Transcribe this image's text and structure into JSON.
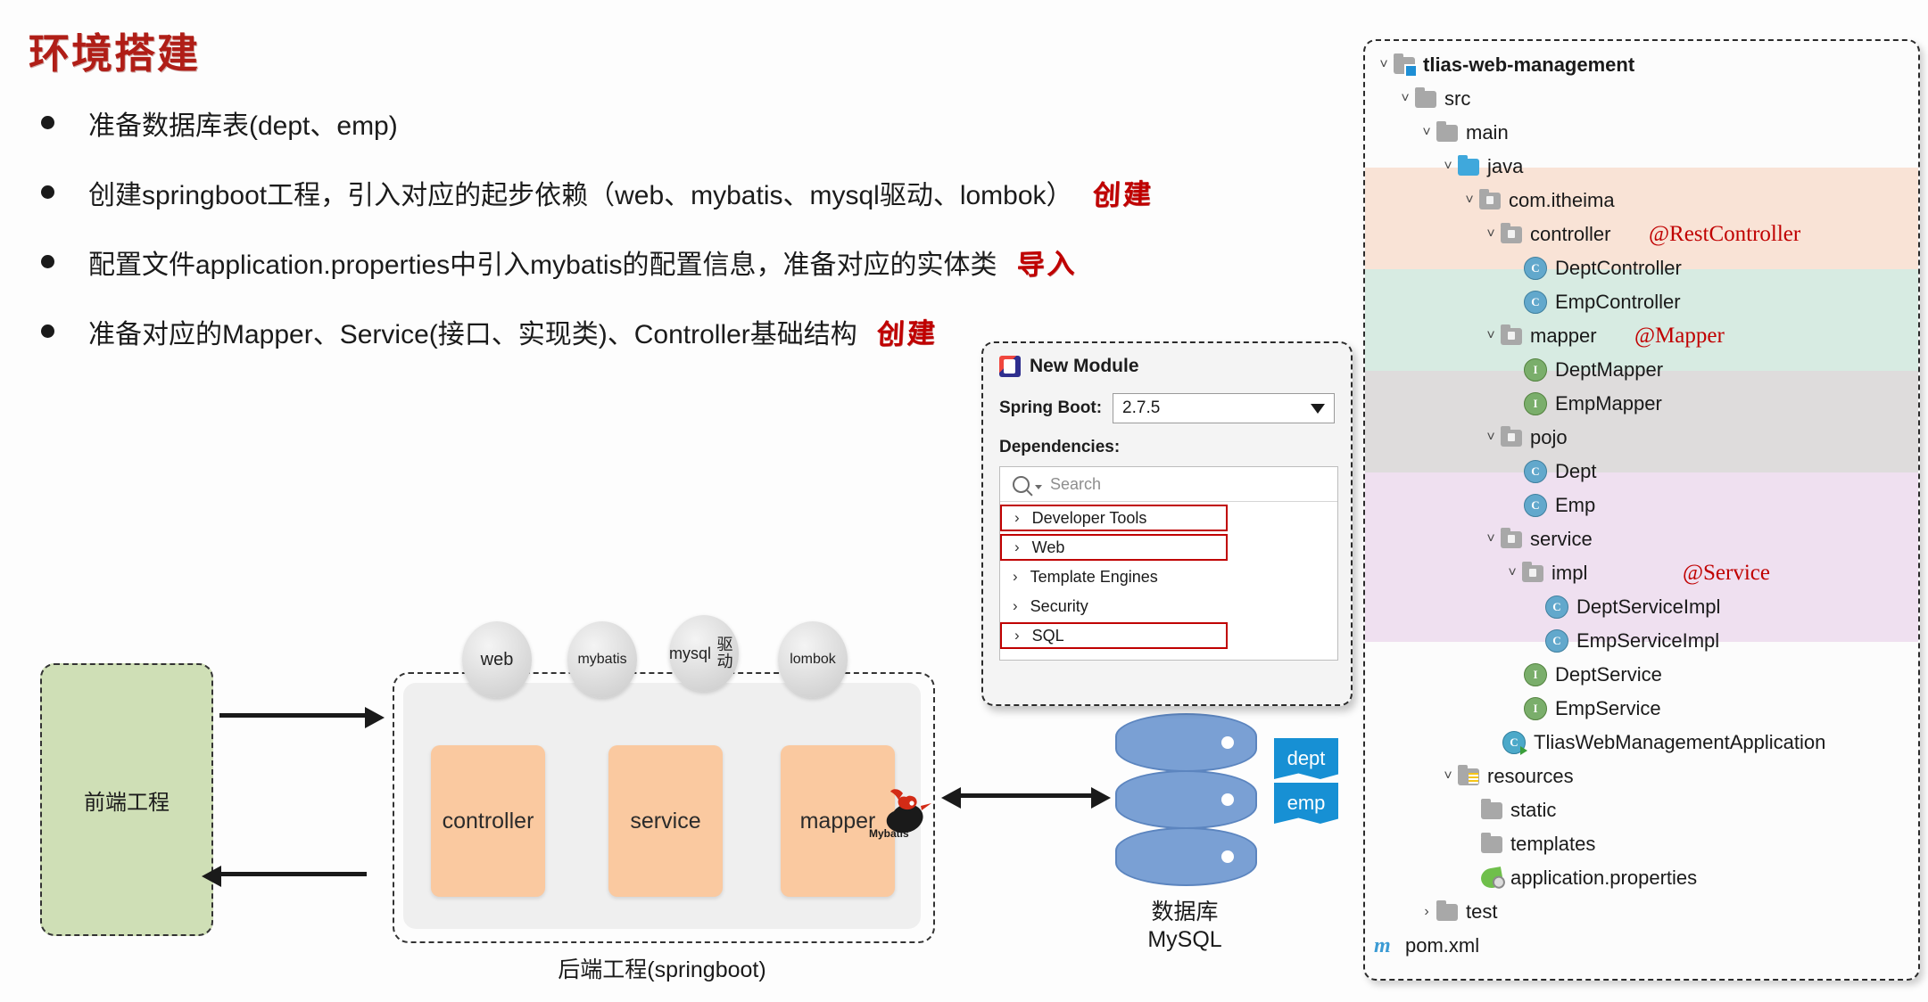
{
  "slide": {
    "title": "环境搭建",
    "title_color": "#B01E17"
  },
  "bullets": [
    {
      "text": "准备数据库表(dept、emp)",
      "annotation": ""
    },
    {
      "text": "创建springboot工程，引入对应的起步依赖（web、mybatis、mysql驱动、lombok）",
      "annotation": "创建"
    },
    {
      "text": "配置文件application.properties中引入mybatis的配置信息，准备对应的实体类",
      "annotation": "导入"
    },
    {
      "text": "准备对应的Mapper、Service(接口、实现类)、Controller基础结构",
      "annotation": "创建"
    }
  ],
  "architecture": {
    "frontend_label": "前端工程",
    "backend_label": "后端工程(springboot)",
    "layers": [
      "controller",
      "service",
      "mapper"
    ],
    "dependencies": [
      "web",
      "mybatis",
      "mysql\n驱动",
      "lombok"
    ],
    "dependency_labels": {
      "web": "web",
      "mybatis": "mybatis",
      "mysql_line1": "mysql",
      "mysql_line2": "驱动",
      "lombok": "lombok"
    },
    "mybatis_logo_caption": "Mybatis",
    "database": {
      "label_line1": "数据库",
      "label_line2": "MySQL",
      "tables": [
        "dept",
        "emp"
      ]
    }
  },
  "dialog": {
    "title": "New Module",
    "spring_boot_label": "Spring Boot:",
    "spring_boot_value": "2.7.5",
    "dependencies_label": "Dependencies:",
    "search_placeholder": "Search",
    "items": [
      {
        "label": "Developer Tools",
        "highlighted": true
      },
      {
        "label": "Web",
        "highlighted": true
      },
      {
        "label": "Template Engines",
        "highlighted": false
      },
      {
        "label": "Security",
        "highlighted": false
      },
      {
        "label": "SQL",
        "highlighted": true
      }
    ]
  },
  "tree": {
    "nodes": [
      {
        "label": "tlias-web-management",
        "indent": 0,
        "arrow": "v",
        "icon": "module-folder",
        "bold": true
      },
      {
        "label": "src",
        "indent": 1,
        "arrow": "v",
        "icon": "folder"
      },
      {
        "label": "main",
        "indent": 2,
        "arrow": "v",
        "icon": "folder"
      },
      {
        "label": "java",
        "indent": 3,
        "arrow": "v",
        "icon": "folder-blue"
      },
      {
        "label": "com.itheima",
        "indent": 4,
        "arrow": "v",
        "icon": "package"
      },
      {
        "label": "controller",
        "indent": 5,
        "arrow": "v",
        "icon": "package",
        "annotation": "@RestController"
      },
      {
        "label": "DeptController",
        "indent": 6,
        "arrow": "",
        "icon": "class-c"
      },
      {
        "label": "EmpController",
        "indent": 6,
        "arrow": "",
        "icon": "class-c"
      },
      {
        "label": "mapper",
        "indent": 5,
        "arrow": "v",
        "icon": "package",
        "annotation": "@Mapper"
      },
      {
        "label": "DeptMapper",
        "indent": 6,
        "arrow": "",
        "icon": "class-i"
      },
      {
        "label": "EmpMapper",
        "indent": 6,
        "arrow": "",
        "icon": "class-i"
      },
      {
        "label": "pojo",
        "indent": 5,
        "arrow": "v",
        "icon": "package"
      },
      {
        "label": "Dept",
        "indent": 6,
        "arrow": "",
        "icon": "class-c"
      },
      {
        "label": "Emp",
        "indent": 6,
        "arrow": "",
        "icon": "class-c"
      },
      {
        "label": "service",
        "indent": 5,
        "arrow": "v",
        "icon": "package"
      },
      {
        "label": "impl",
        "indent": 6,
        "arrow": "v",
        "icon": "package",
        "annotation": "@Service"
      },
      {
        "label": "DeptServiceImpl",
        "indent": 7,
        "arrow": "",
        "icon": "class-c"
      },
      {
        "label": "EmpServiceImpl",
        "indent": 7,
        "arrow": "",
        "icon": "class-c"
      },
      {
        "label": "DeptService",
        "indent": 6,
        "arrow": "",
        "icon": "class-i"
      },
      {
        "label": "EmpService",
        "indent": 6,
        "arrow": "",
        "icon": "class-i"
      },
      {
        "label": "TliasWebManagementApplication",
        "indent": 5,
        "arrow": "",
        "icon": "class-app"
      },
      {
        "label": "resources",
        "indent": 3,
        "arrow": "v",
        "icon": "folder-res"
      },
      {
        "label": "static",
        "indent": 4,
        "arrow": "",
        "icon": "folder"
      },
      {
        "label": "templates",
        "indent": 4,
        "arrow": "",
        "icon": "folder"
      },
      {
        "label": "application.properties",
        "indent": 4,
        "arrow": "",
        "icon": "props-file"
      },
      {
        "label": "test",
        "indent": 2,
        "arrow": ">",
        "icon": "folder"
      },
      {
        "label": "pom.xml",
        "indent": 1,
        "arrow": "",
        "icon": "maven-file"
      }
    ],
    "annotations": {
      "rest_controller": "@RestController",
      "mapper": "@Mapper",
      "service": "@Service"
    },
    "band_colors": {
      "controller": "#F9E3D6",
      "mapper": "#D7EBE2",
      "pojo": "#DEDCDC",
      "service": "#EFE0F0"
    }
  }
}
